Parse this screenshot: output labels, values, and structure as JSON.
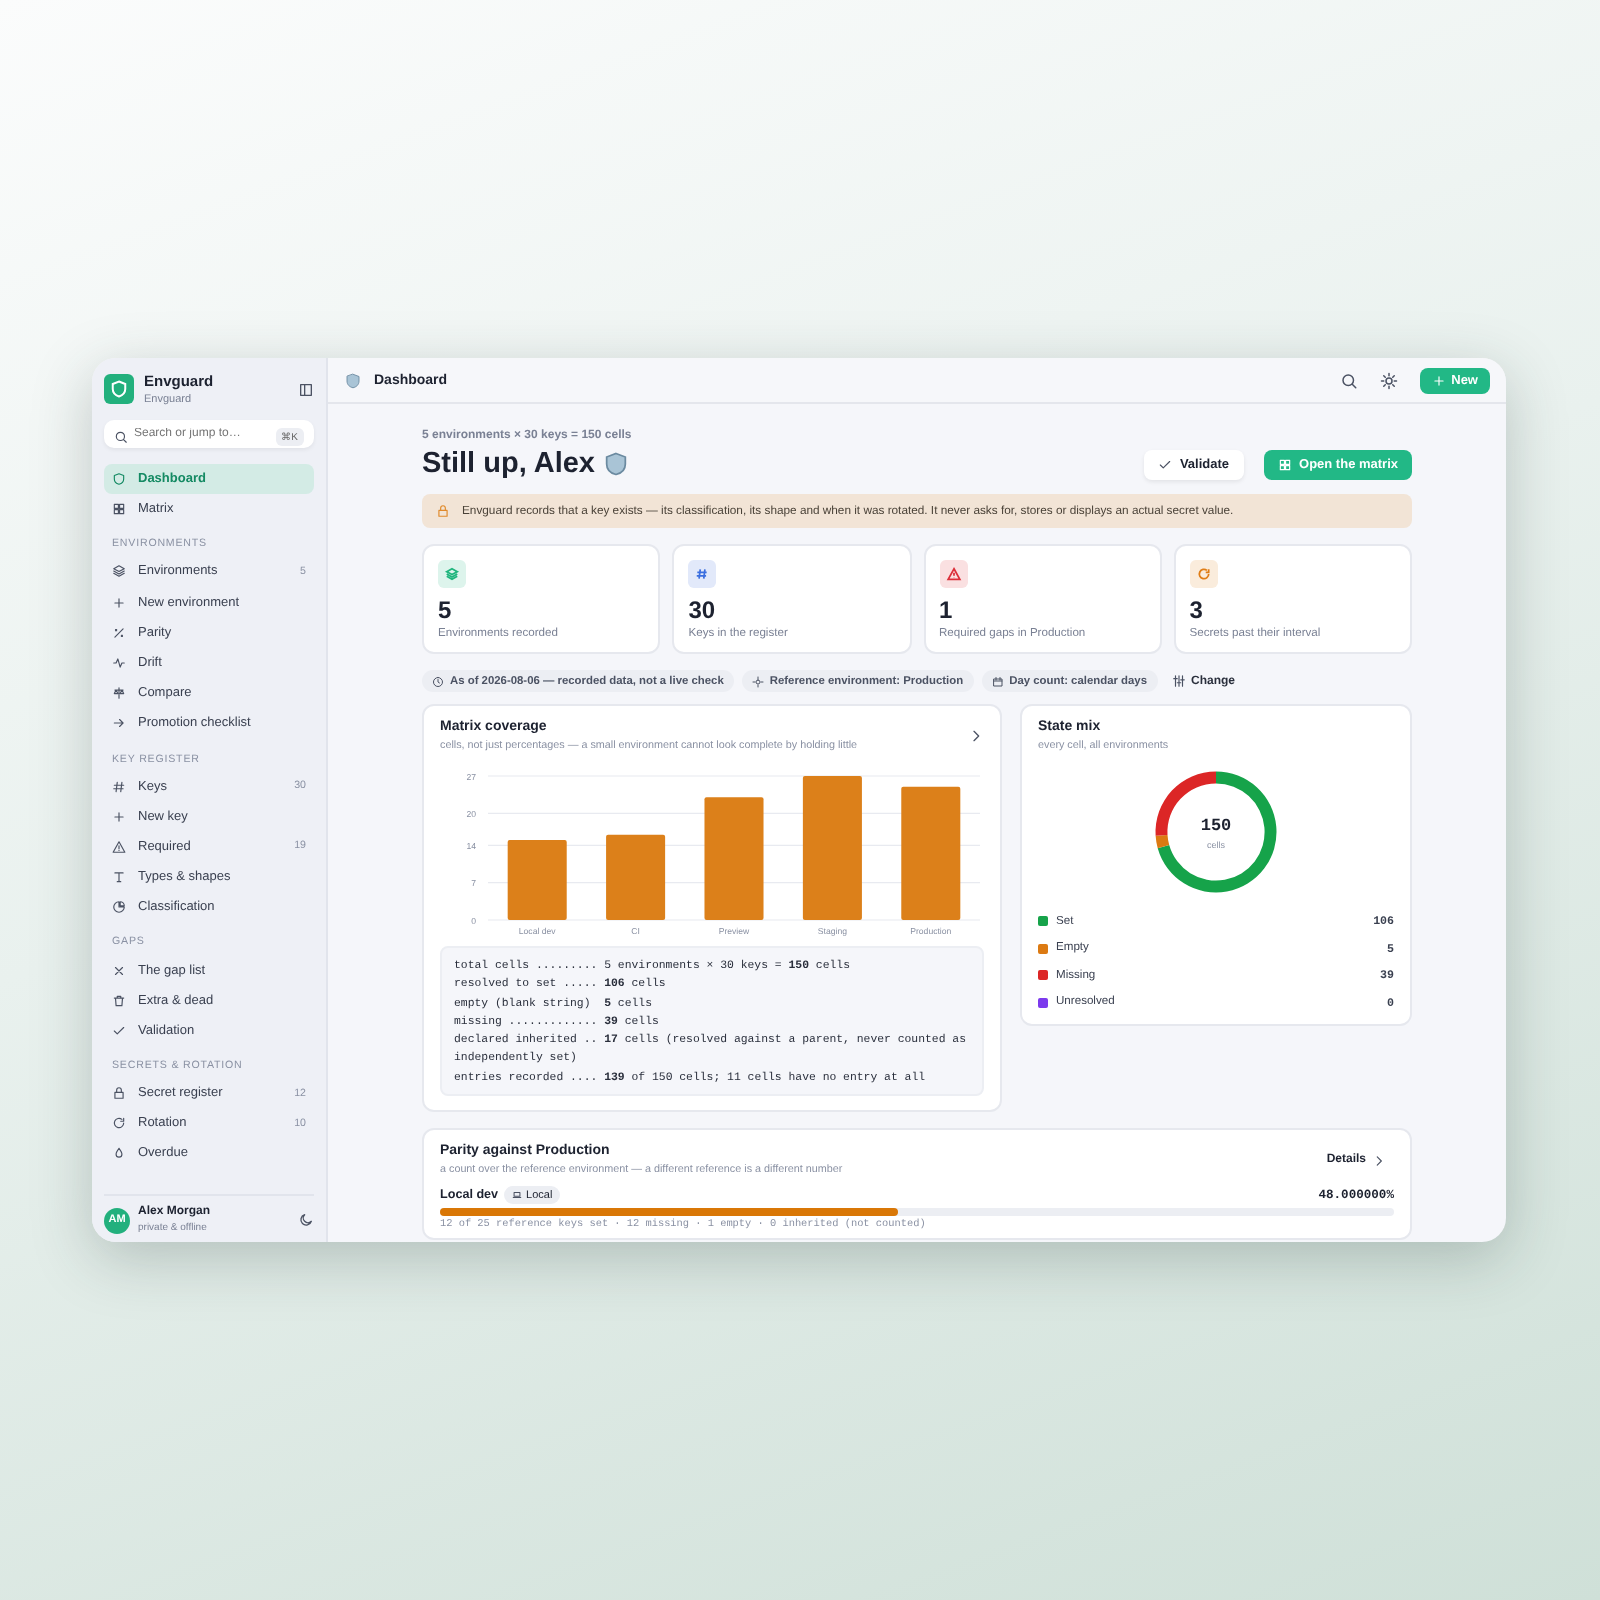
{
  "app": {
    "name": "Envguard",
    "subtitle": "Envguard"
  },
  "search": {
    "placeholder": "Search or jump to…",
    "shortcut": "⌘K"
  },
  "sidebar": {
    "top_items": [
      {
        "label": "Dashboard",
        "selected": true
      },
      {
        "label": "Matrix",
        "selected": false
      }
    ],
    "sections": [
      {
        "heading": "ENVIRONMENTS",
        "items": [
          {
            "label": "Environments",
            "count": "5",
            "selected": false
          },
          {
            "label": "New environment",
            "selected": false
          },
          {
            "label": "Parity",
            "selected": false
          },
          {
            "label": "Drift",
            "selected": false
          },
          {
            "label": "Compare",
            "selected": false
          },
          {
            "label": "Promotion checklist",
            "selected": false
          }
        ]
      },
      {
        "heading": "KEY REGISTER",
        "items": [
          {
            "label": "Keys",
            "count": "30",
            "selected": false
          },
          {
            "label": "New key",
            "selected": false
          },
          {
            "label": "Required",
            "count": "19",
            "selected": false
          },
          {
            "label": "Types & shapes",
            "selected": false
          },
          {
            "label": "Classification",
            "selected": false
          }
        ]
      },
      {
        "heading": "GAPS",
        "items": [
          {
            "label": "The gap list",
            "selected": false
          },
          {
            "label": "Extra & dead",
            "selected": false
          },
          {
            "label": "Validation",
            "selected": false
          }
        ]
      },
      {
        "heading": "SECRETS & ROTATION",
        "items": [
          {
            "label": "Secret register",
            "count": "12",
            "selected": false
          },
          {
            "label": "Rotation",
            "count": "10",
            "selected": false
          },
          {
            "label": "Overdue",
            "selected": false
          }
        ]
      }
    ]
  },
  "user": {
    "initials": "AM",
    "name": "Alex Morgan",
    "status": "private & offline"
  },
  "topbar": {
    "title": "Dashboard",
    "new_button": "New"
  },
  "page": {
    "caption": "5 environments × 30 keys = 150 cells",
    "greeting": "Still up, Alex",
    "buttons": [
      {
        "label": "Validate",
        "kind": "secondary"
      },
      {
        "label": "Open the matrix",
        "kind": "primary"
      }
    ],
    "notice": "Envguard records that a key exists — its classification, its shape and when it was rotated. It never asks for, stores or displays an actual secret value."
  },
  "stats": [
    {
      "value": "5",
      "label": "Environments recorded"
    },
    {
      "value": "30",
      "label": "Keys in the register"
    },
    {
      "value": "1",
      "label": "Required gaps in Production"
    },
    {
      "value": "3",
      "label": "Secrets past their interval"
    }
  ],
  "chips": [
    "As of 2026-08-06 — recorded data, not a live check",
    "Reference environment: Production",
    "Day count: calendar days"
  ],
  "change_button": "Change",
  "coverage": {
    "title": "Matrix coverage",
    "subtitle": "cells, not just percentages — a small environment cannot look complete by holding little",
    "chart_data": {
      "type": "bar",
      "categories": [
        "Local dev",
        "CI",
        "Preview",
        "Staging",
        "Production"
      ],
      "values": [
        15,
        16,
        23,
        27,
        25
      ],
      "ylim": [
        0,
        27
      ],
      "yticks": [
        0,
        7,
        14,
        20,
        27
      ],
      "grid": true
    },
    "summary": [
      "total cells ......... 5 environments × 30 keys = **150** cells",
      "resolved to set ..... **106** cells",
      "empty (blank string)  **5** cells",
      "missing ............. **39** cells",
      "declared inherited .. **17** cells (resolved against a parent, never counted as independently set)",
      "entries recorded .... **139** of 150 cells; 11 cells have no entry at all"
    ]
  },
  "state_mix": {
    "title": "State mix",
    "subtitle": "every cell, all environments",
    "center_value": "150",
    "center_label": "cells",
    "chart_data": {
      "type": "donut",
      "values": [
        70.67,
        3.33,
        26,
        0
      ]
    },
    "legend": [
      {
        "label": "Set",
        "value": "106",
        "color": "#16a34a"
      },
      {
        "label": "Empty",
        "value": "5",
        "color": "#dc7a12"
      },
      {
        "label": "Missing",
        "value": "39",
        "color": "#dc2626"
      },
      {
        "label": "Unresolved",
        "value": "0",
        "color": "#7c3aed"
      }
    ]
  },
  "parity": {
    "title": "Parity against Production",
    "subtitle": "a count over the reference environment — a different reference is a different number",
    "details_button": "Details",
    "rows": [
      {
        "env": "Local dev",
        "tag": "Local",
        "percent": "48.000000%",
        "level": 0.48,
        "note": "12 of 25 reference keys set · 12 missing · 1 empty · 0 inherited (not counted)"
      }
    ]
  }
}
